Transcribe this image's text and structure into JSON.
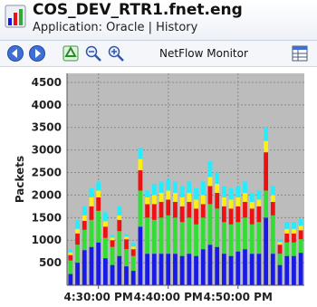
{
  "header": {
    "title": "COS_DEV_RTR1.fnet.eng",
    "subtitle": "Application: Oracle | History",
    "icon": "chart-app-icon"
  },
  "toolbar": {
    "title": "NetFlow Monitor",
    "buttons": [
      {
        "name": "back-button",
        "icon": "arrow-left-icon"
      },
      {
        "name": "forward-button",
        "icon": "arrow-right-icon"
      },
      {
        "name": "refresh-button",
        "icon": "recycle-icon"
      },
      {
        "name": "zoom-out-button",
        "icon": "zoom-out-icon"
      },
      {
        "name": "zoom-in-button",
        "icon": "zoom-in-icon"
      },
      {
        "name": "export-button",
        "icon": "spreadsheet-icon"
      }
    ]
  },
  "colors": {
    "plot_background": "#bcbcbc",
    "series": [
      "#1a1ae6",
      "#33dd33",
      "#ee1111",
      "#ffee11",
      "#22eeff"
    ]
  },
  "chart_data": {
    "type": "bar",
    "stacked": true,
    "ylabel": "Packets",
    "ylim": [
      0,
      4700
    ],
    "yticks": [
      500,
      1000,
      1500,
      2000,
      2500,
      3000,
      3500,
      4000,
      4500
    ],
    "x_tick_labels": [
      "4:30:00 PM",
      "4:40:00 PM",
      "4:50:00 PM"
    ],
    "x_tick_positions": [
      4,
      14,
      24
    ],
    "grid": true,
    "series": [
      {
        "values": [
          250,
          500,
          780,
          850,
          950,
          600,
          450,
          650,
          420,
          320,
          1300,
          700,
          700,
          700,
          700,
          700,
          650,
          700,
          650,
          800,
          900,
          850,
          700,
          650,
          750,
          800,
          700,
          700,
          1500,
          700,
          450,
          650,
          650,
          720
        ]
      },
      {
        "values": [
          300,
          400,
          450,
          600,
          700,
          450,
          400,
          550,
          380,
          330,
          800,
          800,
          750,
          800,
          850,
          800,
          750,
          800,
          700,
          700,
          900,
          850,
          700,
          700,
          650,
          700,
          650,
          700,
          600,
          850,
          250,
          300,
          300,
          300
        ]
      },
      {
        "values": [
          120,
          250,
          200,
          300,
          300,
          250,
          150,
          250,
          220,
          150,
          450,
          300,
          350,
          350,
          350,
          350,
          350,
          350,
          350,
          300,
          400,
          350,
          350,
          350,
          350,
          350,
          350,
          350,
          850,
          300,
          200,
          200,
          200,
          200
        ]
      },
      {
        "values": [
          60,
          100,
          120,
          200,
          150,
          120,
          60,
          100,
          60,
          60,
          250,
          150,
          200,
          200,
          200,
          200,
          200,
          200,
          200,
          200,
          200,
          200,
          200,
          200,
          200,
          200,
          150,
          150,
          250,
          150,
          60,
          100,
          100,
          100
        ]
      },
      {
        "values": [
          60,
          200,
          200,
          200,
          200,
          200,
          50,
          200,
          50,
          80,
          250,
          150,
          250,
          250,
          250,
          250,
          250,
          250,
          250,
          300,
          350,
          250,
          250,
          250,
          250,
          250,
          200,
          200,
          300,
          200,
          50,
          150,
          150,
          150
        ]
      }
    ]
  }
}
